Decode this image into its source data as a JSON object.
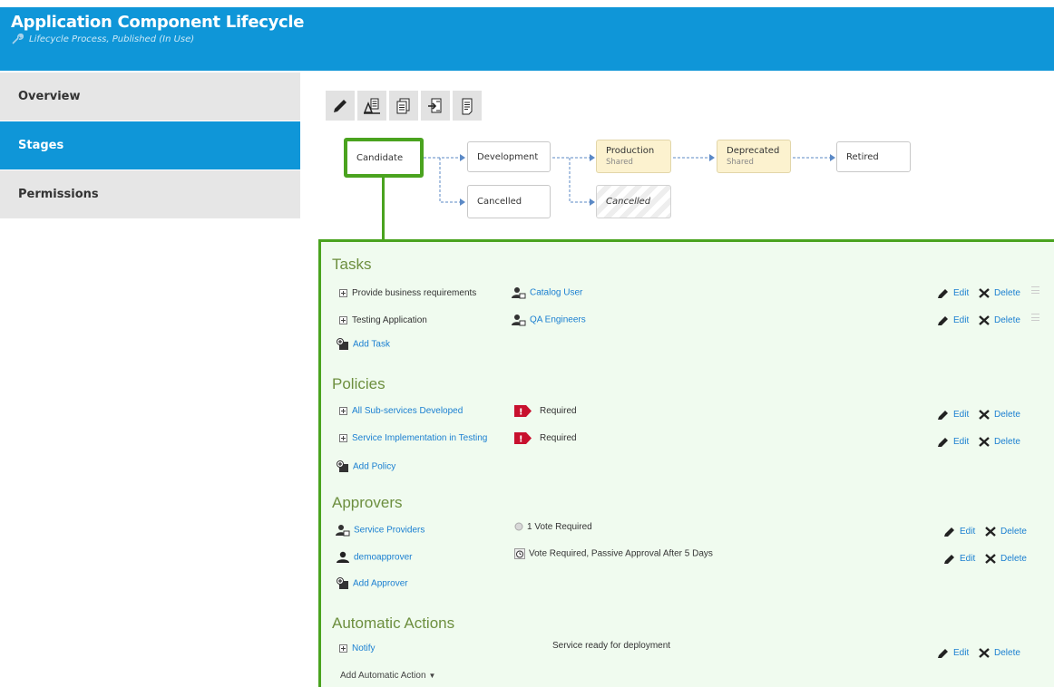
{
  "header": {
    "title": "Application Component Lifecycle",
    "subtitle": "Lifecycle Process, Published (In Use)"
  },
  "sidebar": {
    "items": [
      {
        "label": "Overview"
      },
      {
        "label": "Stages"
      },
      {
        "label": "Permissions"
      }
    ],
    "active_index": 1
  },
  "toolbar": {
    "buttons": [
      "edit-icon",
      "edit-stage-icon",
      "copy-icon",
      "import-icon",
      "document-icon"
    ]
  },
  "stages": {
    "candidate": "Candidate",
    "development": "Development",
    "production": "Production",
    "production_sub": "Shared",
    "deprecated": "Deprecated",
    "deprecated_sub": "Shared",
    "retired": "Retired",
    "cancelled_1": "Cancelled",
    "cancelled_2": "Cancelled"
  },
  "tasks": {
    "title": "Tasks",
    "items": [
      {
        "name": "Provide business requirements",
        "assignee": "Catalog User"
      },
      {
        "name": "Testing Application",
        "assignee": "QA Engineers"
      }
    ],
    "add_label": "Add Task"
  },
  "policies": {
    "title": "Policies",
    "items": [
      {
        "name": "All Sub-services Developed",
        "status": "Required"
      },
      {
        "name": "Service Implementation in Testing",
        "status": "Required"
      }
    ],
    "add_label": "Add Policy"
  },
  "approvers": {
    "title": "Approvers",
    "items": [
      {
        "name": "Service Providers",
        "rule": "1 Vote Required"
      },
      {
        "name": "demoapprover",
        "rule": "Vote Required, Passive Approval After 5 Days"
      }
    ],
    "add_label": "Add Approver"
  },
  "automatic_actions": {
    "title": "Automatic Actions",
    "items": [
      {
        "name": "Notify",
        "description": "Service ready for deployment"
      }
    ],
    "add_label": "Add Automatic Action"
  },
  "actions": {
    "edit": "Edit",
    "delete": "Delete"
  },
  "colors": {
    "brand_blue": "#0f96d8",
    "selected_green": "#4aa31f",
    "section_title": "#6d8f3f",
    "link": "#1a7fd1",
    "shared_stage": "#fcf2cf",
    "required_red": "#c8102e"
  }
}
